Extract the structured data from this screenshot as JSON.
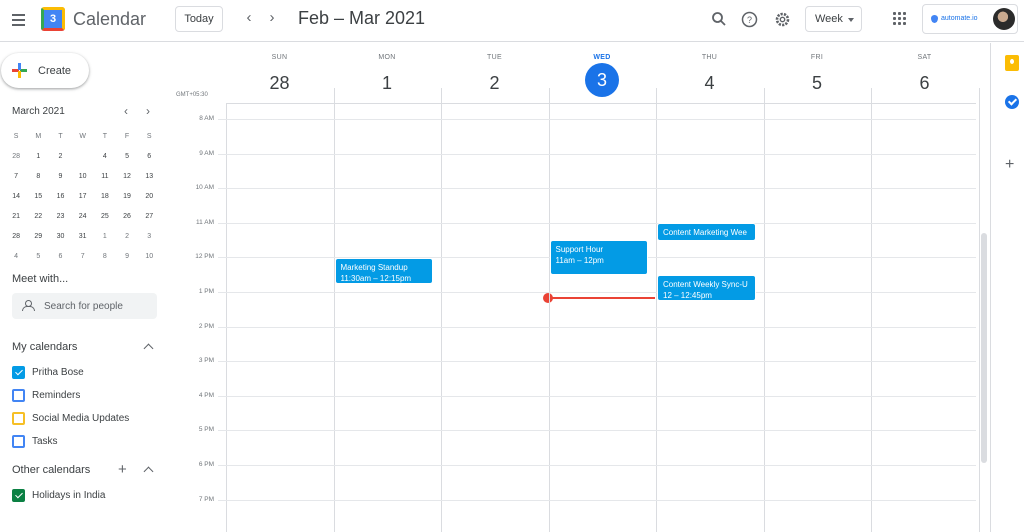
{
  "header": {
    "app_title": "Calendar",
    "logo_day": "3",
    "today_label": "Today",
    "prev_arrow": "‹",
    "next_arrow": "›",
    "period": "Feb – Mar 2021",
    "view_label": "Week",
    "account_brand": "automate.io"
  },
  "sidebar": {
    "create_label": "Create",
    "mini_calendar": {
      "title": "March 2021",
      "weekdays": [
        "S",
        "M",
        "T",
        "W",
        "T",
        "F",
        "S"
      ],
      "weeks": [
        [
          "28",
          "1",
          "2",
          "3",
          "4",
          "5",
          "6"
        ],
        [
          "7",
          "8",
          "9",
          "10",
          "11",
          "12",
          "13"
        ],
        [
          "14",
          "15",
          "16",
          "17",
          "18",
          "19",
          "20"
        ],
        [
          "21",
          "22",
          "23",
          "24",
          "25",
          "26",
          "27"
        ],
        [
          "28",
          "29",
          "30",
          "31",
          "1",
          "2",
          "3"
        ],
        [
          "4",
          "5",
          "6",
          "7",
          "8",
          "9",
          "10"
        ]
      ],
      "selected": "3"
    },
    "meet_title": "Meet with...",
    "search_placeholder": "Search for people",
    "my_calendars_title": "My calendars",
    "my_calendars": [
      {
        "label": "Pritha Bose",
        "color": "#039be5",
        "checked": true
      },
      {
        "label": "Reminders",
        "color": "#4285f4",
        "checked": false
      },
      {
        "label": "Social Media Updates",
        "color": "#f6bf26",
        "checked": false
      },
      {
        "label": "Tasks",
        "color": "#4285f4",
        "checked": false
      }
    ],
    "other_calendars_title": "Other calendars",
    "other_calendars": [
      {
        "label": "Holidays in India",
        "color": "#0b8043",
        "checked": true
      }
    ]
  },
  "week": {
    "timezone": "GMT+05:30",
    "days": [
      {
        "dow": "SUN",
        "num": "28",
        "today": false
      },
      {
        "dow": "MON",
        "num": "1",
        "today": false
      },
      {
        "dow": "TUE",
        "num": "2",
        "today": false
      },
      {
        "dow": "WED",
        "num": "3",
        "today": true
      },
      {
        "dow": "THU",
        "num": "4",
        "today": false
      },
      {
        "dow": "FRI",
        "num": "5",
        "today": false
      },
      {
        "dow": "SAT",
        "num": "6",
        "today": false
      }
    ],
    "hours": [
      "8 AM",
      "9 AM",
      "10 AM",
      "11 AM",
      "12 PM",
      "1 PM",
      "2 PM",
      "3 PM",
      "4 PM",
      "5 PM",
      "6 PM",
      "7 PM"
    ],
    "events": [
      {
        "title": "Marketing Standup",
        "time": "11:30am – 12:15pm",
        "color": "#039be5"
      },
      {
        "title": "Support Hour",
        "time": "11am – 12pm",
        "color": "#039be5"
      },
      {
        "title": "Content Marketing Wee",
        "time": "",
        "color": "#039be5"
      },
      {
        "title": "Content Weekly Sync-U",
        "time": "12 – 12:45pm",
        "color": "#039be5"
      }
    ]
  },
  "icons": {
    "search": "search-icon",
    "help": "help-icon",
    "settings": "gear-icon",
    "apps": "apps-grid-icon",
    "keep": "keep-icon",
    "tasks": "tasks-icon"
  }
}
